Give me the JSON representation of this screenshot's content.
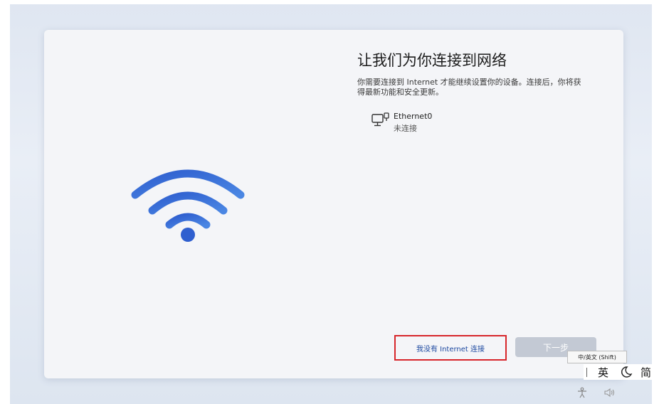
{
  "setup": {
    "title": "让我们为你连接到网络",
    "description": "你需要连接到 Internet 才能继续设置你的设备。连接后，你将获得最新功能和安全更新。",
    "network": {
      "name": "Ethernet0",
      "status": "未连接"
    },
    "no_internet_label": "我没有 Internet 连接",
    "next_label": "下一步"
  },
  "ime": {
    "tooltip": "中/英文 (Shift)",
    "language": "英",
    "script": "简"
  },
  "icons": {
    "wifi": "wifi-icon",
    "network": "ethernet-monitor-icon",
    "halfwidth": "half-moon-icon",
    "accessibility": "accessibility-icon",
    "volume": "volume-icon"
  },
  "colors": {
    "wifi": "#3b6fd6",
    "highlight": "#d7262b",
    "link": "#1d49a0",
    "next_disabled": "#c3c9d4"
  }
}
